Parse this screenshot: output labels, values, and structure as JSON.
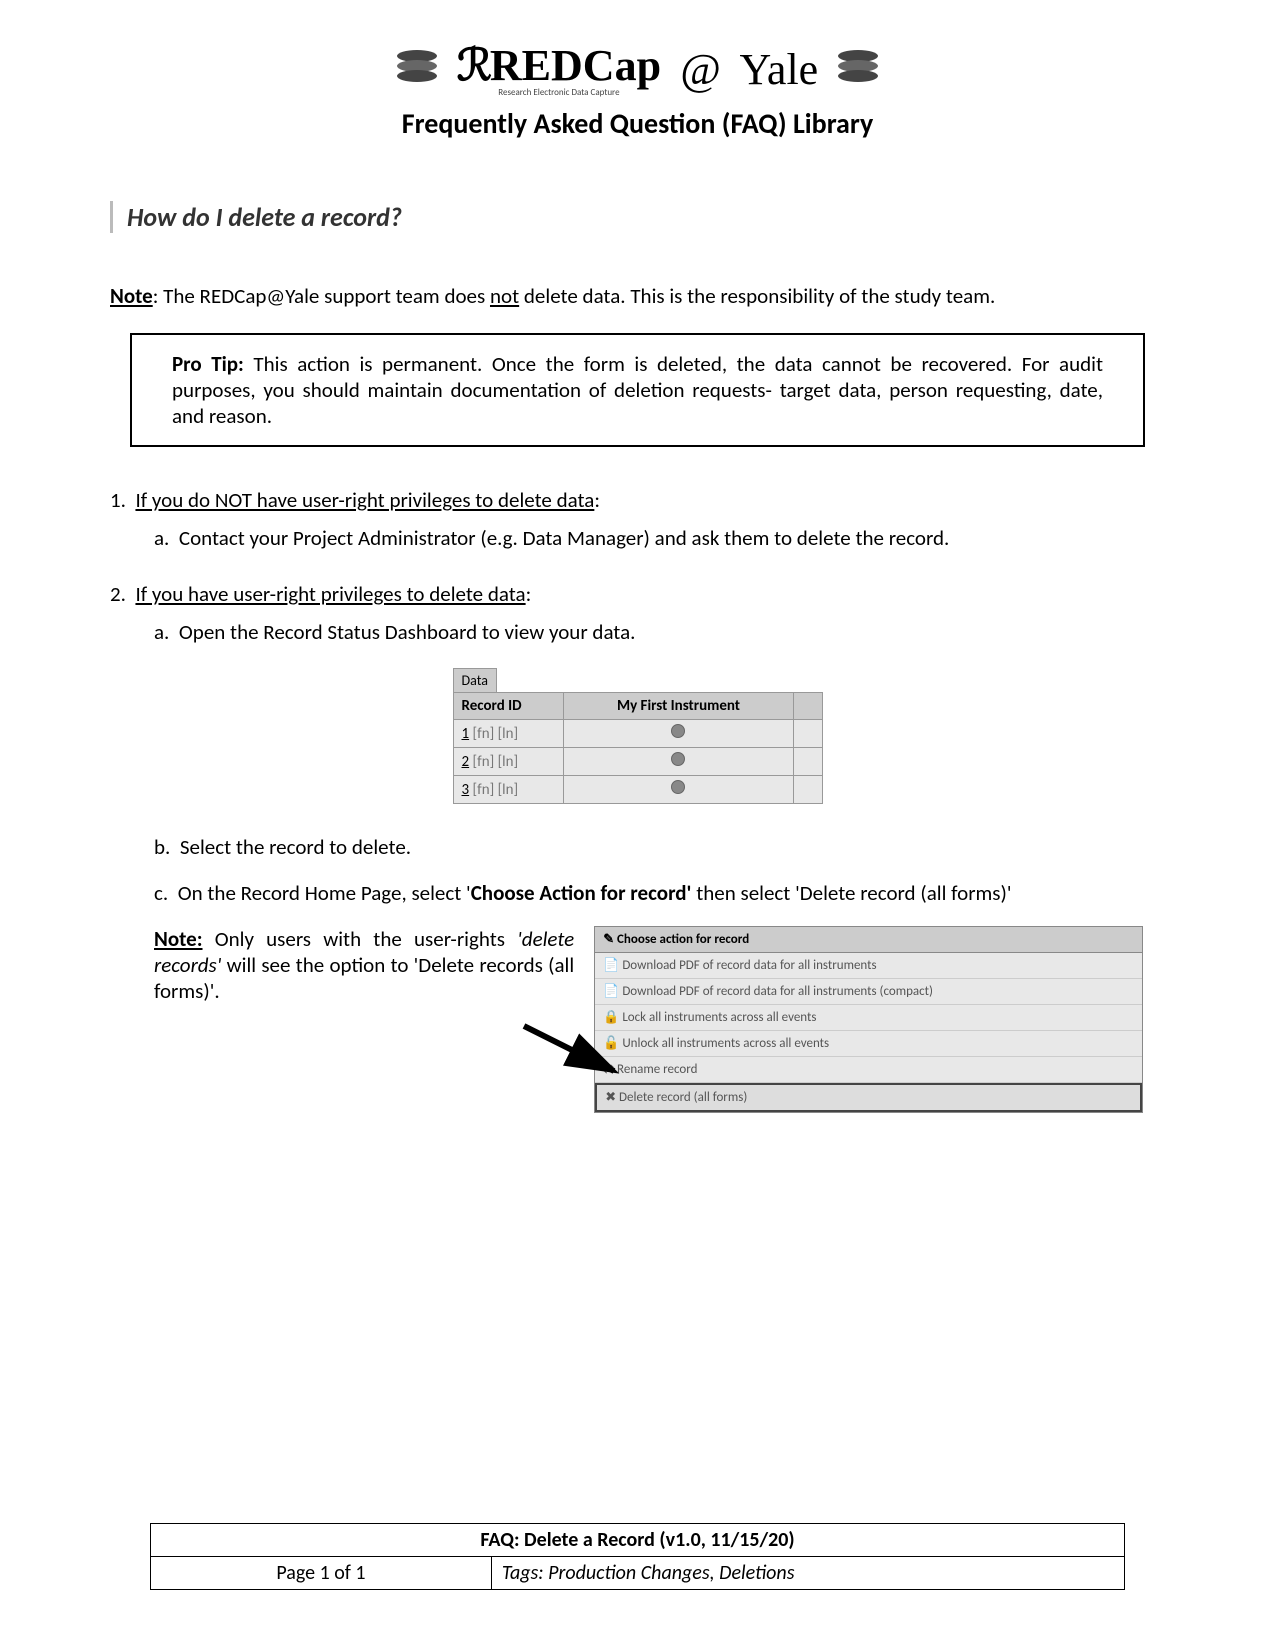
{
  "header": {
    "brand_redcap": "REDCap",
    "brand_sub": "Research Electronic Data Capture",
    "brand_at": "@",
    "brand_yale": "Yale",
    "subtitle": "Frequently Asked Question (FAQ) Library"
  },
  "question": "How do I delete a record?",
  "note": {
    "label": "Note",
    "before_not": ": The REDCap@Yale support team does ",
    "not": "not",
    "after_not": " delete data.  This is the responsibility of the study team."
  },
  "pro_tip": {
    "label": "Pro Tip:",
    "text": " This action is permanent.  Once the form is deleted, the data cannot be recovered. For audit purposes, you should maintain documentation of deletion requests- target data, person requesting, date, and reason."
  },
  "section1": {
    "num": "1.",
    "title": "If you do NOT have user-right privileges to delete data",
    "a_label": "a.",
    "a_text": "Contact your Project Administrator (e.g. Data Manager) and ask them to delete the record."
  },
  "section2": {
    "num": "2.",
    "title": "If you have user-right privileges to delete data",
    "a_label": "a.",
    "a_text": "Open the Record Status Dashboard to view your data.",
    "b_label": "b.",
    "b_text": "Select the record to delete.",
    "c_label": "c.",
    "c_before": "On the Record Home Page, select '",
    "c_bold": "Choose Action for record'",
    "c_after": " then select 'Delete record (all forms)'"
  },
  "dashboard": {
    "tab": "Data",
    "col1": "Record ID",
    "col2": "My First Instrument",
    "rows": [
      {
        "id": "1",
        "name": "[fn] [ln]"
      },
      {
        "id": "2",
        "name": "[fn] [ln]"
      },
      {
        "id": "3",
        "name": "[fn] [ln]"
      }
    ]
  },
  "step_c_note": {
    "label": "Note:",
    "t1": " Only users with the user-rights ",
    "it": "'delete records'",
    "t2": " will see the option to 'Delete records (all forms)'."
  },
  "action_menu": {
    "header": "✎ Choose action for record",
    "items": [
      "📄 Download PDF of record data for all instruments",
      "📄 Download PDF of record data for all instruments (compact)",
      "🔒 Lock all instruments across all events",
      "🔓 Unlock all instruments across all events",
      "⇄ Rename record",
      "✖ Delete record (all forms)"
    ]
  },
  "footer": {
    "title": "FAQ: Delete a Record (v1.0, 11/15/20)",
    "page": "Page 1 of 1",
    "tags": "Tags: Production Changes, Deletions"
  }
}
